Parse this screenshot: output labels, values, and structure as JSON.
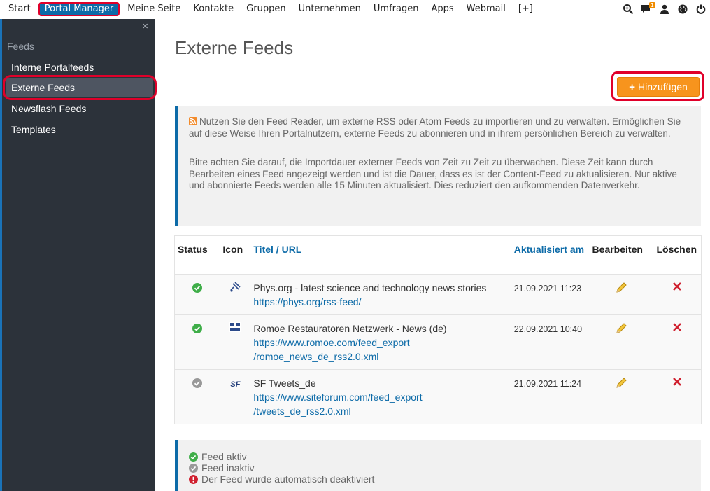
{
  "nav": {
    "items": [
      "Start",
      "Portal Manager",
      "Meine Seite",
      "Kontakte",
      "Gruppen",
      "Unternehmen",
      "Umfragen",
      "Apps",
      "Webmail",
      "[+]"
    ],
    "active": "Portal Manager",
    "notification_count": "1",
    "icons": [
      "search-icon",
      "chat-icon",
      "user-icon",
      "globe-icon",
      "power-icon"
    ]
  },
  "sidebar": {
    "close": "×",
    "heading": "Feeds",
    "items": [
      {
        "label": "Interne Portalfeeds"
      },
      {
        "label": "Externe Feeds"
      },
      {
        "label": "Newsflash Feeds"
      },
      {
        "label": "Templates"
      }
    ]
  },
  "page": {
    "title": "Externe Feeds",
    "add_button": "Hinzufügen"
  },
  "info": {
    "paragraph1": "Nutzen Sie den Feed Reader, um externe RSS oder Atom Feeds zu importieren und zu verwalten. Ermöglichen Sie auf diese Weise Ihren Portalnutzern, externe Feeds zu abonnieren und in ihrem persönlichen Bereich zu verwalten.",
    "paragraph2": "Bitte achten Sie darauf, die Importdauer externer Feeds von Zeit zu Zeit zu überwachen. Diese Zeit kann durch Bearbeiten eines Feed angezeigt werden und ist die Dauer, dass es ist der Content-Feed zu aktualisieren. Nur aktive und abonnierte Feeds werden alle 15 Minuten aktualisiert. Dies reduziert den aufkommenden Datenverkehr."
  },
  "table": {
    "headers": {
      "status": "Status",
      "icon": "Icon",
      "title": "Titel",
      "sep": " / ",
      "url": "URL",
      "updated": "Aktualisiert am",
      "edit": "Bearbeiten",
      "delete": "Löschen"
    },
    "rows": [
      {
        "status": "active",
        "icon": "satellite-icon",
        "title": "Phys.org - latest science and technology news stories",
        "url_line1": "https://phys.org/rss-feed/",
        "url_line2": "",
        "updated": "21.09.2021 11:23"
      },
      {
        "status": "active",
        "icon": "romoe-logo-icon",
        "title": "Romoe Restauratoren Netzwerk - News (de)",
        "url_line1": "https://www.romoe.com/feed_export",
        "url_line2": "/romoe_news_de_rss2.0.xml",
        "updated": "22.09.2021 10:40"
      },
      {
        "status": "inactive",
        "icon": "sf-logo-icon",
        "icon_text": "SF",
        "title": "SF Tweets_de",
        "url_line1": "https://www.siteforum.com/feed_export",
        "url_line2": "/tweets_de_rss2.0.xml",
        "updated": "21.09.2021 11:24"
      }
    ]
  },
  "legend": {
    "active": "Feed aktiv",
    "inactive": "Feed inaktiv",
    "deactivated": "Der Feed wurde automatisch deaktiviert"
  },
  "colors": {
    "accent": "#0d6ba8",
    "sidebar_bg": "#2c323a",
    "add_button": "#f7941d",
    "highlight": "#e0002a",
    "active_status": "#3fae49",
    "inactive_status": "#999999"
  }
}
